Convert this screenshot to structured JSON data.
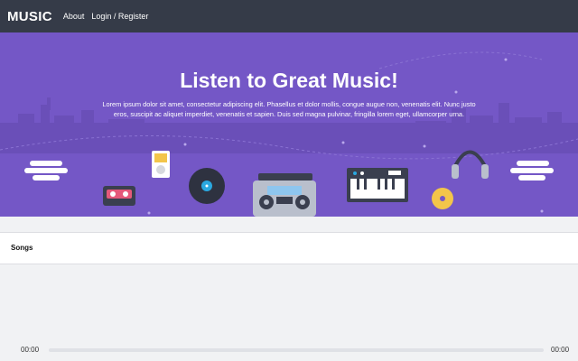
{
  "nav": {
    "brand": "MUSIC",
    "links": [
      "About",
      "Login / Register"
    ]
  },
  "hero": {
    "title": "Listen to Great Music!",
    "text": "Lorem ipsum dolor sit amet, consectetur adipiscing elit. Phasellus et dolor mollis, congue augue non, venenatis elit. Nunc justo eros, suscipit ac aliquet imperdiet, venenatis et sapien. Duis sed magna pulvinar, fringilla lorem eget, ullamcorper urna."
  },
  "songs": {
    "title": "Songs"
  },
  "player": {
    "current_time": "00:00",
    "duration": "00:00",
    "progress": 0
  },
  "colors": {
    "navbar": "#353b48",
    "hero": "#7457c6",
    "page_bg": "#f1f2f4"
  }
}
